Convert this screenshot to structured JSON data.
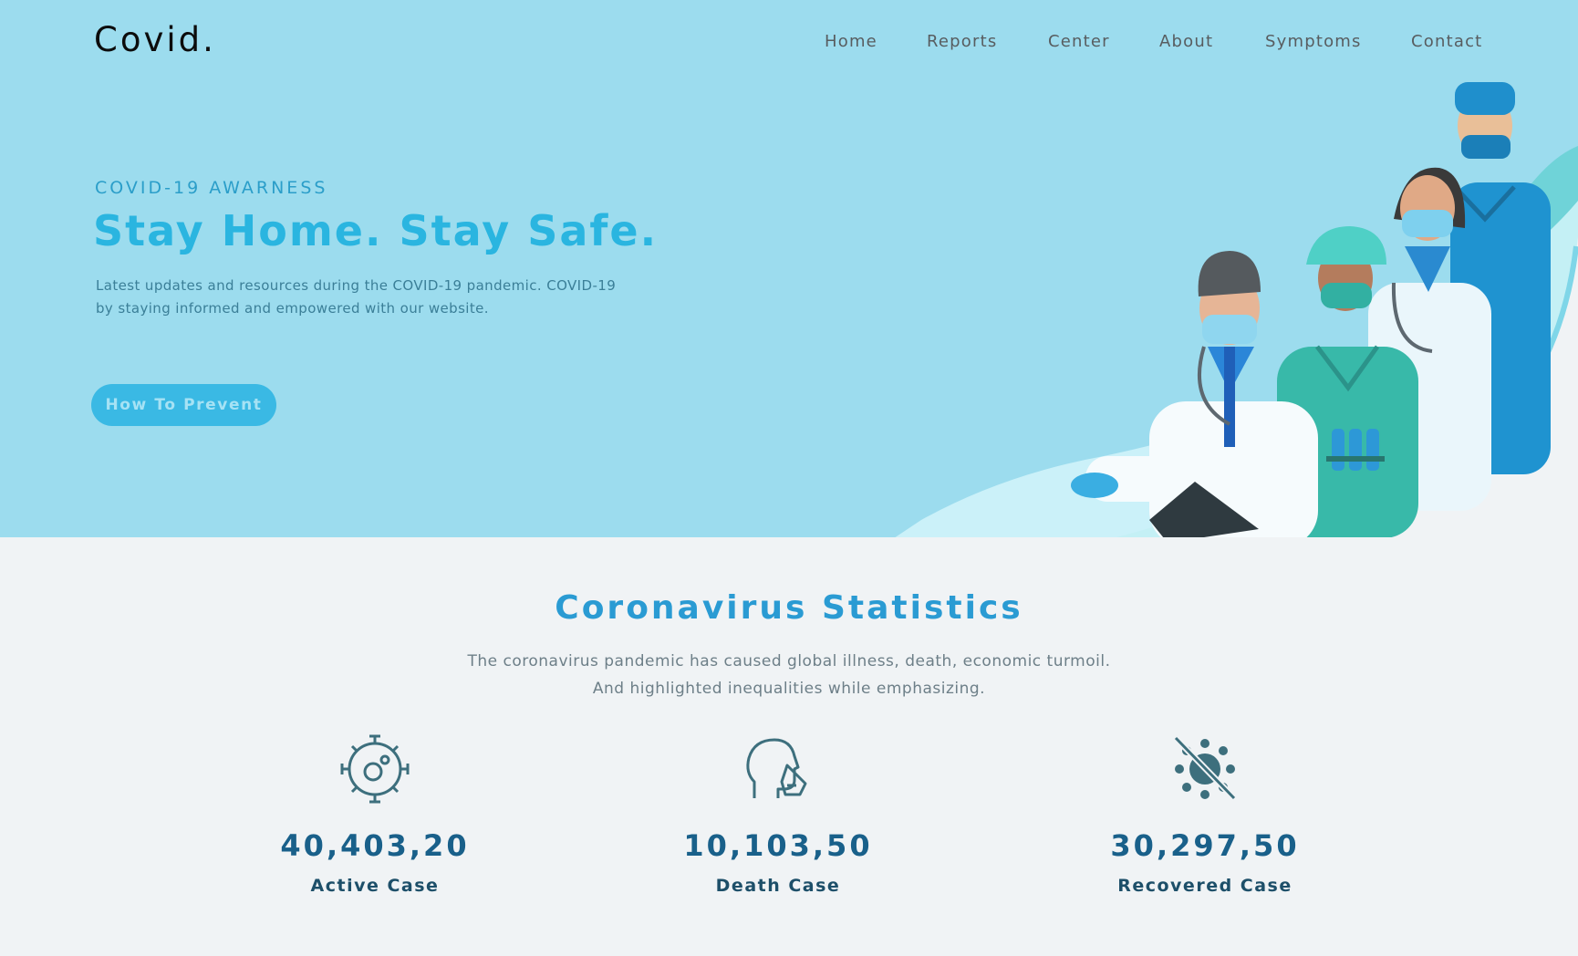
{
  "brand": {
    "logo": "Covid."
  },
  "nav": {
    "items": [
      {
        "label": "Home"
      },
      {
        "label": "Reports"
      },
      {
        "label": "Center"
      },
      {
        "label": "About"
      },
      {
        "label": "Symptoms"
      },
      {
        "label": "Contact"
      }
    ]
  },
  "hero": {
    "eyebrow": "COVID-19 AWARNESS",
    "headline": "Stay Home. Stay Safe.",
    "lede_line1": "Latest updates and resources during the COVID-19 pandemic. COVID-19",
    "lede_line2": "by staying informed and empowered with our website.",
    "cta_label": "How To Prevent"
  },
  "statistics": {
    "title": "Coronavirus Statistics",
    "desc_line1": "The coronavirus pandemic has caused global illness, death, economic turmoil.",
    "desc_line2": "And highlighted inequalities while emphasizing.",
    "items": [
      {
        "icon": "virus-icon",
        "value": "40,403,20",
        "label": "Active Case"
      },
      {
        "icon": "head-mask-icon",
        "value": "10,103,50",
        "label": "Death Case"
      },
      {
        "icon": "virus-crossed-icon",
        "value": "30,297,50",
        "label": "Recovered Case"
      }
    ]
  },
  "colors": {
    "hero_bg": "#9cdcee",
    "accent": "#2ab5e0",
    "stats_number": "#19608a",
    "page_bg": "#f0f3f5"
  }
}
